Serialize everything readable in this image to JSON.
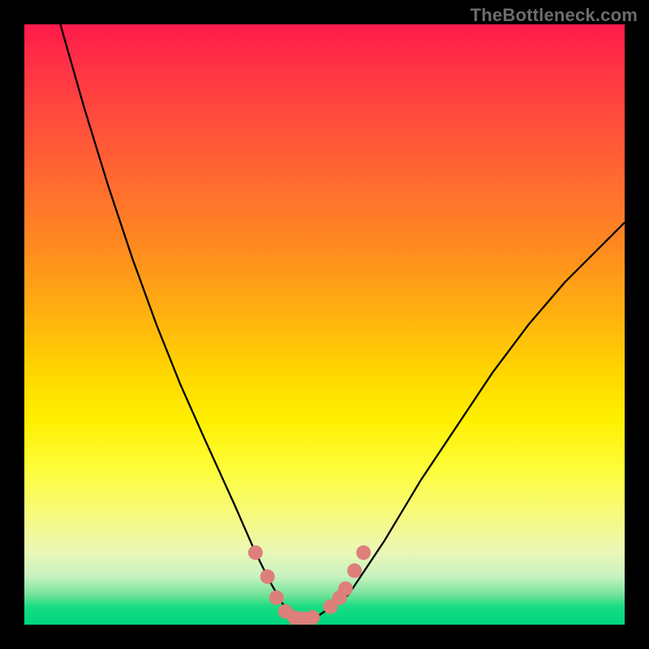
{
  "watermark": "TheBottleneck.com",
  "colors": {
    "curve": "#000000",
    "markers": "#dd7f7a",
    "frame": "#000000"
  },
  "chart_data": {
    "type": "line",
    "title": "",
    "xlabel": "",
    "ylabel": "",
    "xlim": [
      0,
      100
    ],
    "ylim": [
      0,
      100
    ],
    "grid": false,
    "series": [
      {
        "name": "bottleneck-curve",
        "x": [
          6,
          10,
          14,
          18,
          22,
          26,
          30,
          35,
          38.5,
          41,
          43,
          45,
          47,
          49,
          54,
          60,
          66,
          72,
          78,
          84,
          90,
          96,
          100
        ],
        "y": [
          100,
          86,
          73,
          61,
          50,
          40,
          31,
          20,
          12,
          7,
          3.5,
          1.5,
          1,
          1.5,
          5,
          14,
          24,
          33,
          42,
          50,
          57,
          63,
          67
        ]
      }
    ],
    "markers": {
      "name": "highlighted-points",
      "points": [
        {
          "x": 38.5,
          "y": 12
        },
        {
          "x": 40.5,
          "y": 8
        },
        {
          "x": 42,
          "y": 4.5
        },
        {
          "x": 43.5,
          "y": 2.2
        },
        {
          "x": 45,
          "y": 1.2
        },
        {
          "x": 46.5,
          "y": 1
        },
        {
          "x": 48,
          "y": 1.2
        },
        {
          "x": 51,
          "y": 3
        },
        {
          "x": 52.5,
          "y": 4.5
        },
        {
          "x": 53.5,
          "y": 6
        },
        {
          "x": 55,
          "y": 9
        },
        {
          "x": 56.5,
          "y": 12
        }
      ]
    }
  }
}
